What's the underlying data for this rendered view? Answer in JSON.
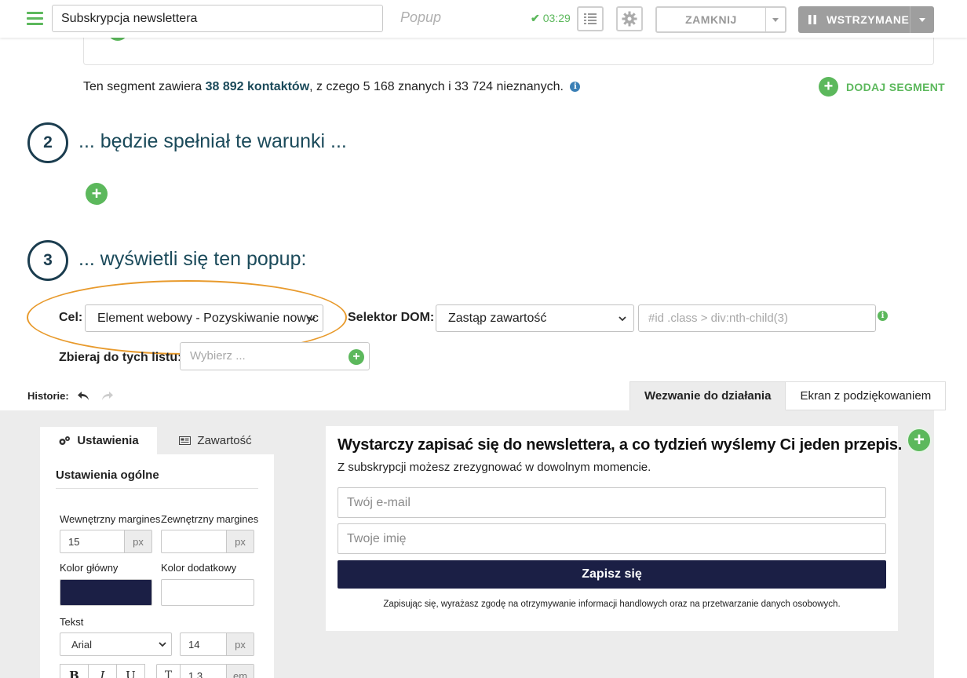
{
  "topbar": {
    "title_value": "Subskrypcja newslettera",
    "type_label": "Popup",
    "timer": "03:29",
    "close_label": "ZAMKNIJ",
    "status_label": "WSTRZYMANE",
    "accent_color": "#5cb85c"
  },
  "segment": {
    "info_prefix": "Ten segment zawiera ",
    "contacts": "38 892 kontaktów",
    "info_suffix": ", z czego 5 168 znanych i 33 724 nieznanych.",
    "add_segment_label": "DODAJ SEGMENT"
  },
  "steps": [
    {
      "number": "2",
      "title": "... będzie spełniał te warunki ..."
    },
    {
      "number": "3",
      "title": "... wyświetli się ten popup:"
    }
  ],
  "form": {
    "goal_label": "Cel:",
    "goal_value": "Element webowy - Pozyskiwanie nowyc",
    "dom_label": "Selektor DOM:",
    "dom_value": "Zastąp zawartość",
    "selector_placeholder": "#id .class > div:nth-child(3)",
    "lists_label": "Zbieraj do tych listu:",
    "lists_placeholder": "Wybierz ..."
  },
  "history": {
    "label": "Historie:"
  },
  "tabs": [
    "Wezwanie do działania",
    "Ekran z podziękowaniem"
  ],
  "settings": {
    "tab_settings": "Ustawienia",
    "tab_content": "Zawartość",
    "section_title": "Ustawienia ogólne",
    "inner_margin_label": "Wewnętrzny margines",
    "inner_margin_value": "15",
    "outer_margin_label": "Zewnętrzny margines",
    "outer_margin_value": "",
    "unit_px": "px",
    "unit_em": "em",
    "primary_color_label": "Kolor główny",
    "primary_color": "#1b1f45",
    "secondary_color_label": "Kolor dodatkowy",
    "secondary_color": "#ffffff",
    "text_label": "Tekst",
    "font_value": "Arial",
    "font_size": "14",
    "line_height": "1,3",
    "bold": "B",
    "italic": "I",
    "underline": "U",
    "line_height_icon_text": "T"
  },
  "preview": {
    "title": "Wystarczy zapisać się do newslettera, a co tydzień wyślemy Ci jeden przepis.",
    "subtitle": "Z subskrypcji możesz zrezygnować w dowolnym momencie.",
    "email_placeholder": "Twój e-mail",
    "name_placeholder": "Twoje imię",
    "button_label": "Zapisz się",
    "consent": "Zapisując się, wyrażasz zgodę na otrzymywanie informacji handlowych oraz na przetwarzanie danych osobowych."
  }
}
